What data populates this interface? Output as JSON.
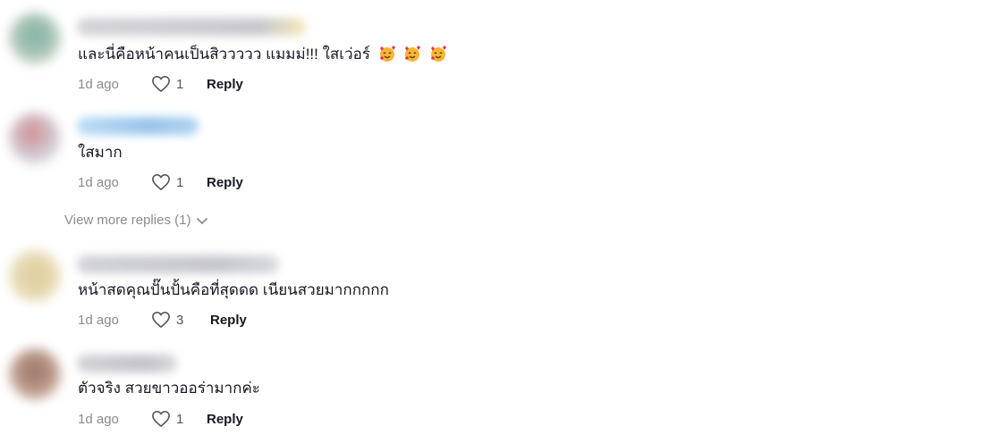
{
  "comments": [
    {
      "text": "และนี่คือหน้าคนเป็นสิววววว แมมม่!!! ใสเว่อร์",
      "emoji_count": 3,
      "emoji_icon": "smiling-face-with-hearts-icon",
      "time": "1d ago",
      "likes": "1",
      "reply": "Reply"
    },
    {
      "text": "ใสมาก",
      "time": "1d ago",
      "likes": "1",
      "reply": "Reply"
    },
    {
      "text": "หน้าสดคุณปั๊นปั้นคือที่สุดดด เนียนสวยมากกกกก",
      "time": "1d ago",
      "likes": "3",
      "reply": "Reply"
    },
    {
      "text": "ตัวจริง สวยขาวออร่ามากค่ะ",
      "time": "1d ago",
      "likes": "1",
      "reply": "Reply"
    }
  ],
  "view_more_replies": "View more replies (1)",
  "colors": {
    "time_gray": "#8a8b91",
    "text_dark": "#161823"
  }
}
